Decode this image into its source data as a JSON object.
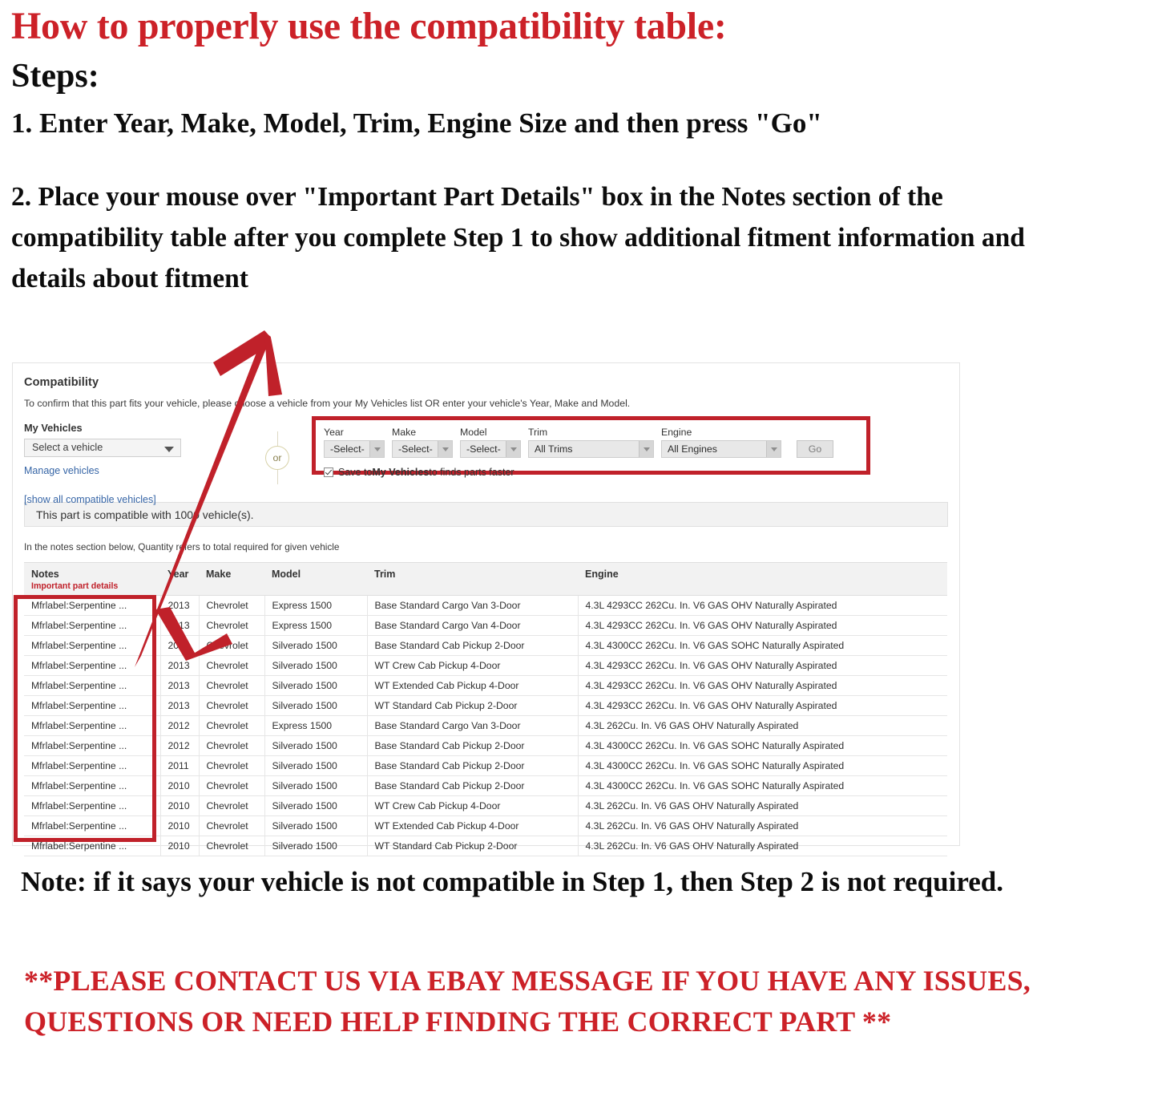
{
  "instructions": {
    "heading_red": "How to properly use the compatibility table:",
    "steps_label": "Steps:",
    "step_1": "1. Enter Year, Make, Model, Trim, Engine Size and then press \"Go\"",
    "step_2": "2. Place your mouse over \"Important Part Details\" box in the Notes section of the compatibility table after you complete Step 1 to show additional fitment information and details about fitment",
    "note_bottom": "Note: if it says your vehicle is not compatible in Step 1, then Step 2 is not required.",
    "contact_red": "**PLEASE CONTACT US VIA EBAY MESSAGE IF YOU HAVE ANY ISSUES, QUESTIONS OR NEED HELP FINDING THE CORRECT PART **"
  },
  "panel": {
    "title": "Compatibility",
    "subtitle": "To confirm that this part fits your vehicle, please choose a vehicle from your My Vehicles list OR enter your vehicle's Year, Make and Model.",
    "my_vehicles_label": "My Vehicles",
    "vehicle_select_value": "Select a vehicle",
    "manage_vehicles_link": "Manage vehicles",
    "show_all_link": "[show all compatible vehicles]",
    "or_label": "or",
    "compatible_banner": "This part is compatible with 1000 vehicle(s).",
    "notes_hint": "In the notes section below, Quantity refers to total required for given vehicle",
    "form": {
      "year": {
        "label": "Year",
        "value": "-Select-"
      },
      "make": {
        "label": "Make",
        "value": "-Select-"
      },
      "model": {
        "label": "Model",
        "value": "-Select-"
      },
      "trim": {
        "label": "Trim",
        "value": "All Trims"
      },
      "engine": {
        "label": "Engine",
        "value": "All Engines"
      },
      "go_button": "Go",
      "save_prefix": "Save to ",
      "save_bold": "My Vehicles",
      "save_suffix": " to finds parts faster"
    }
  },
  "table": {
    "headers": {
      "notes": "Notes",
      "notes_sub": "Important part details",
      "year": "Year",
      "make": "Make",
      "model": "Model",
      "trim": "Trim",
      "engine": "Engine"
    },
    "rows": [
      {
        "notes": "Mfrlabel:Serpentine ...",
        "year": "2013",
        "make": "Chevrolet",
        "model": "Express 1500",
        "trim": "Base Standard Cargo Van 3-Door",
        "engine": "4.3L 4293CC 262Cu. In. V6 GAS OHV Naturally Aspirated"
      },
      {
        "notes": "Mfrlabel:Serpentine ...",
        "year": "2013",
        "make": "Chevrolet",
        "model": "Express 1500",
        "trim": "Base Standard Cargo Van 4-Door",
        "engine": "4.3L 4293CC 262Cu. In. V6 GAS OHV Naturally Aspirated"
      },
      {
        "notes": "Mfrlabel:Serpentine ...",
        "year": "2013",
        "make": "Chevrolet",
        "model": "Silverado 1500",
        "trim": "Base Standard Cab Pickup 2-Door",
        "engine": "4.3L 4300CC 262Cu. In. V6 GAS SOHC Naturally Aspirated"
      },
      {
        "notes": "Mfrlabel:Serpentine ...",
        "year": "2013",
        "make": "Chevrolet",
        "model": "Silverado 1500",
        "trim": "WT Crew Cab Pickup 4-Door",
        "engine": "4.3L 4293CC 262Cu. In. V6 GAS OHV Naturally Aspirated"
      },
      {
        "notes": "Mfrlabel:Serpentine ...",
        "year": "2013",
        "make": "Chevrolet",
        "model": "Silverado 1500",
        "trim": "WT Extended Cab Pickup 4-Door",
        "engine": "4.3L 4293CC 262Cu. In. V6 GAS OHV Naturally Aspirated"
      },
      {
        "notes": "Mfrlabel:Serpentine ...",
        "year": "2013",
        "make": "Chevrolet",
        "model": "Silverado 1500",
        "trim": "WT Standard Cab Pickup 2-Door",
        "engine": "4.3L 4293CC 262Cu. In. V6 GAS OHV Naturally Aspirated"
      },
      {
        "notes": "Mfrlabel:Serpentine ...",
        "year": "2012",
        "make": "Chevrolet",
        "model": "Express 1500",
        "trim": "Base Standard Cargo Van 3-Door",
        "engine": "4.3L 262Cu. In. V6 GAS OHV Naturally Aspirated"
      },
      {
        "notes": "Mfrlabel:Serpentine ...",
        "year": "2012",
        "make": "Chevrolet",
        "model": "Silverado 1500",
        "trim": "Base Standard Cab Pickup 2-Door",
        "engine": "4.3L 4300CC 262Cu. In. V6 GAS SOHC Naturally Aspirated"
      },
      {
        "notes": "Mfrlabel:Serpentine ...",
        "year": "2011",
        "make": "Chevrolet",
        "model": "Silverado 1500",
        "trim": "Base Standard Cab Pickup 2-Door",
        "engine": "4.3L 4300CC 262Cu. In. V6 GAS SOHC Naturally Aspirated"
      },
      {
        "notes": "Mfrlabel:Serpentine ...",
        "year": "2010",
        "make": "Chevrolet",
        "model": "Silverado 1500",
        "trim": "Base Standard Cab Pickup 2-Door",
        "engine": "4.3L 4300CC 262Cu. In. V6 GAS SOHC Naturally Aspirated"
      },
      {
        "notes": "Mfrlabel:Serpentine ...",
        "year": "2010",
        "make": "Chevrolet",
        "model": "Silverado 1500",
        "trim": "WT Crew Cab Pickup 4-Door",
        "engine": "4.3L 262Cu. In. V6 GAS OHV Naturally Aspirated"
      },
      {
        "notes": "Mfrlabel:Serpentine ...",
        "year": "2010",
        "make": "Chevrolet",
        "model": "Silverado 1500",
        "trim": "WT Extended Cab Pickup 4-Door",
        "engine": "4.3L 262Cu. In. V6 GAS OHV Naturally Aspirated"
      },
      {
        "notes": "Mfrlabel:Serpentine ...",
        "year": "2010",
        "make": "Chevrolet",
        "model": "Silverado 1500",
        "trim": "WT Standard Cab Pickup 2-Door",
        "engine": "4.3L 262Cu. In. V6 GAS OHV Naturally Aspirated"
      }
    ]
  },
  "colors": {
    "annotation_red": "#c0212a",
    "heading_red": "#cc2128",
    "link_blue": "#3665a6"
  }
}
